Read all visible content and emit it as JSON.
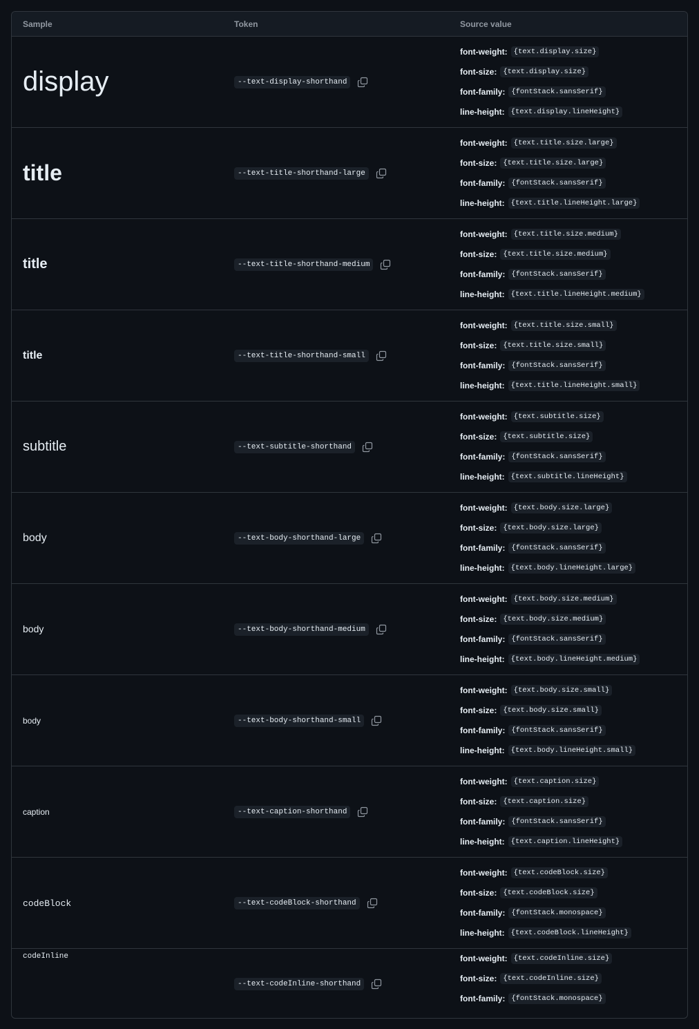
{
  "header": {
    "sample": "Sample",
    "token": "Token",
    "source": "Source value"
  },
  "rows": [
    {
      "sample": "display",
      "token": "--text-display-shorthand",
      "src": [
        [
          "font-weight:",
          "{text.display.size}"
        ],
        [
          "font-size:",
          "{text.display.size}"
        ],
        [
          "font-family:",
          "{fontStack.sansSerif}"
        ],
        [
          "line-height:",
          "{text.display.lineHeight}"
        ]
      ]
    },
    {
      "sample": "title",
      "token": "--text-title-shorthand-large",
      "src": [
        [
          "font-weight:",
          "{text.title.size.large}"
        ],
        [
          "font-size:",
          "{text.title.size.large}"
        ],
        [
          "font-family:",
          "{fontStack.sansSerif}"
        ],
        [
          "line-height:",
          "{text.title.lineHeight.large}"
        ]
      ]
    },
    {
      "sample": "title",
      "token": "--text-title-shorthand-medium",
      "src": [
        [
          "font-weight:",
          "{text.title.size.medium}"
        ],
        [
          "font-size:",
          "{text.title.size.medium}"
        ],
        [
          "font-family:",
          "{fontStack.sansSerif}"
        ],
        [
          "line-height:",
          "{text.title.lineHeight.medium}"
        ]
      ]
    },
    {
      "sample": "title",
      "token": "--text-title-shorthand-small",
      "src": [
        [
          "font-weight:",
          "{text.title.size.small}"
        ],
        [
          "font-size:",
          "{text.title.size.small}"
        ],
        [
          "font-family:",
          "{fontStack.sansSerif}"
        ],
        [
          "line-height:",
          "{text.title.lineHeight.small}"
        ]
      ]
    },
    {
      "sample": "subtitle",
      "token": "--text-subtitle-shorthand",
      "src": [
        [
          "font-weight:",
          "{text.subtitle.size}"
        ],
        [
          "font-size:",
          "{text.subtitle.size}"
        ],
        [
          "font-family:",
          "{fontStack.sansSerif}"
        ],
        [
          "line-height:",
          "{text.subtitle.lineHeight}"
        ]
      ]
    },
    {
      "sample": "body",
      "token": "--text-body-shorthand-large",
      "src": [
        [
          "font-weight:",
          "{text.body.size.large}"
        ],
        [
          "font-size:",
          "{text.body.size.large}"
        ],
        [
          "font-family:",
          "{fontStack.sansSerif}"
        ],
        [
          "line-height:",
          "{text.body.lineHeight.large}"
        ]
      ]
    },
    {
      "sample": "body",
      "token": "--text-body-shorthand-medium",
      "src": [
        [
          "font-weight:",
          "{text.body.size.medium}"
        ],
        [
          "font-size:",
          "{text.body.size.medium}"
        ],
        [
          "font-family:",
          "{fontStack.sansSerif}"
        ],
        [
          "line-height:",
          "{text.body.lineHeight.medium}"
        ]
      ]
    },
    {
      "sample": "body",
      "token": "--text-body-shorthand-small",
      "src": [
        [
          "font-weight:",
          "{text.body.size.small}"
        ],
        [
          "font-size:",
          "{text.body.size.small}"
        ],
        [
          "font-family:",
          "{fontStack.sansSerif}"
        ],
        [
          "line-height:",
          "{text.body.lineHeight.small}"
        ]
      ]
    },
    {
      "sample": "caption",
      "token": "--text-caption-shorthand",
      "src": [
        [
          "font-weight:",
          "{text.caption.size}"
        ],
        [
          "font-size:",
          "{text.caption.size}"
        ],
        [
          "font-family:",
          "{fontStack.sansSerif}"
        ],
        [
          "line-height:",
          "{text.caption.lineHeight}"
        ]
      ]
    },
    {
      "sample": "codeBlock",
      "token": "--text-codeBlock-shorthand",
      "src": [
        [
          "font-weight:",
          "{text.codeBlock.size}"
        ],
        [
          "font-size:",
          "{text.codeBlock.size}"
        ],
        [
          "font-family:",
          "{fontStack.monospace}"
        ],
        [
          "line-height:",
          "{text.codeBlock.lineHeight}"
        ]
      ]
    },
    {
      "sample": "codeInline",
      "token": "--text-codeInline-shorthand",
      "src": [
        [
          "font-weight:",
          "{text.codeInline.size}"
        ],
        [
          "font-size:",
          "{text.codeInline.size}"
        ],
        [
          "font-family:",
          "{fontStack.monospace}"
        ]
      ]
    }
  ]
}
